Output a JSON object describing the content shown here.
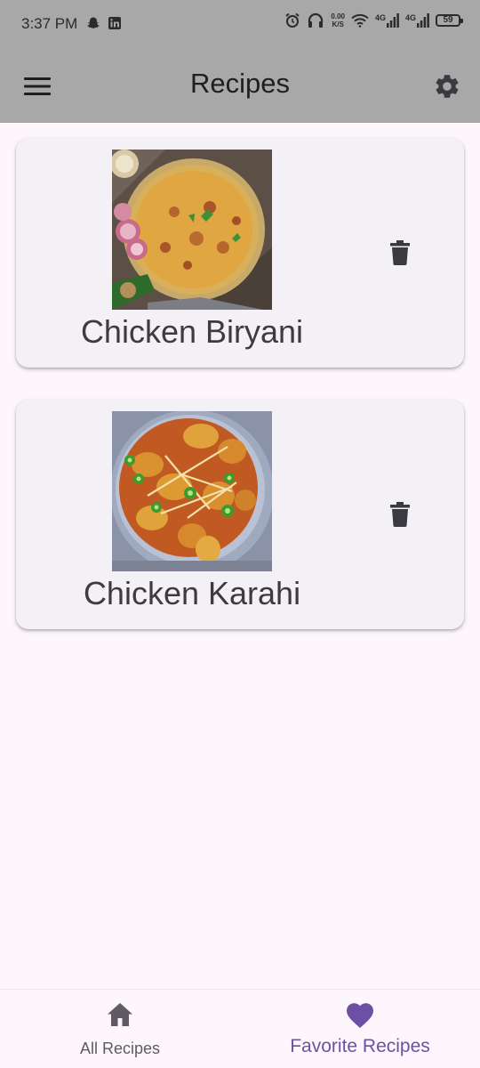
{
  "status_bar": {
    "time": "3:37 PM",
    "left_icons": [
      "snapchat-icon",
      "linkedin-icon"
    ],
    "speed_value": "0.00",
    "speed_unit": "K/S",
    "network_1": "4G",
    "network_2": "4G",
    "battery_level": "59",
    "right_icons": [
      "alarm-icon",
      "headphones-icon",
      "wifi-icon",
      "signal-icon",
      "signal-icon",
      "battery-icon"
    ]
  },
  "app_bar": {
    "title": "Recipes",
    "menu_icon": "menu-icon",
    "settings_icon": "gear-icon"
  },
  "recipes": [
    {
      "name": "Chicken Biryani",
      "image": "chicken-biryani-photo",
      "delete_icon": "trash-icon"
    },
    {
      "name": "Chicken Karahi",
      "image": "chicken-karahi-photo",
      "delete_icon": "trash-icon"
    }
  ],
  "bottom_nav": {
    "items": [
      {
        "label": "All Recipes",
        "icon": "home-icon",
        "selected": false
      },
      {
        "label": "Favorite Recipes",
        "icon": "heart-icon",
        "selected": true
      }
    ]
  },
  "colors": {
    "app_bar_background": "#a8a8a8",
    "page_background": "#fdf7fd",
    "card_background": "#f4f1f6",
    "accent_selected": "#6e4fa6",
    "icon_dark": "#3a3a40",
    "nav_unselected": "#5f5b63"
  }
}
